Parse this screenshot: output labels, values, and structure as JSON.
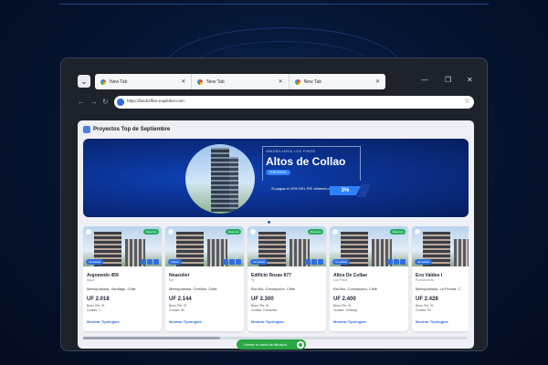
{
  "browser": {
    "tabs": [
      {
        "label": "New Tab"
      },
      {
        "label": "New Tab"
      },
      {
        "label": "New Tab"
      }
    ],
    "url": "https://backoffice.eoplinker.com"
  },
  "page": {
    "title": "Proyectos Top de Septiembre",
    "banner": {
      "eyebrow": "INMOBILIARIA LOS PINOS",
      "title": "Altos de Collao",
      "badge": "PREVENTA",
      "promo": "Si pagas el 10% DEL PIE obtienes el",
      "percent": "3%"
    },
    "cards": [
      {
        "name": "Argomedo 459",
        "developer": "Aquix",
        "location": "Metropolitana, Santiago, Chile",
        "price": "UF 2.018",
        "bono": "Bono Pie: Si",
        "cuotas": "Cuotas: 1",
        "tag_right": "Reserva",
        "tag_left": "Inmediata",
        "link": "Mostrar Tipologías"
      },
      {
        "name": "Neasolier",
        "developer": "Eje",
        "location": "Metropolitana, Cerrillos, Chile",
        "price": "UF 2.144",
        "bono": "Bono Pie: Si",
        "cuotas": "Cuotas: 50",
        "tag_right": "Reserva",
        "tag_left": "Futura",
        "link": "Mostrar Tipologías"
      },
      {
        "name": "Edificio Rozas 877",
        "developer": "Fy",
        "location": "Bío-Bío, Concepción, Chile",
        "price": "UF 2.300",
        "bono": "Bono Pie: Si",
        "cuotas": "Cuotas: Consultar",
        "tag_right": "Reserva",
        "tag_left": "Inmediata",
        "link": "Mostrar Tipologías"
      },
      {
        "name": "Altos De Collao",
        "developer": "Los Pinos",
        "location": "Bío-Bío, Concepción, Chile",
        "price": "UF 2.400",
        "bono": "Bono Pie: Si",
        "cuotas": "Cuotas: 12/Abap.",
        "tag_right": "Reserva",
        "tag_left": "Inmediata",
        "link": "Mostrar Tipologías"
      },
      {
        "name": "Eco Valdes I",
        "developer": "Fundamenta",
        "location": "Metropolitana, La Florida, C",
        "price": "UF 2.428",
        "bono": "Bono Pie: Si",
        "cuotas": "Cuotas: 50",
        "tag_right": "Reserva",
        "tag_left": "Inmediata",
        "link": "Mostrar Tipologías"
      }
    ]
  },
  "whatsapp_button": "Unirse al canal de difusión",
  "colors": {
    "accent": "#2f6fe0",
    "success": "#28a745",
    "banner": "#0a2d86"
  }
}
